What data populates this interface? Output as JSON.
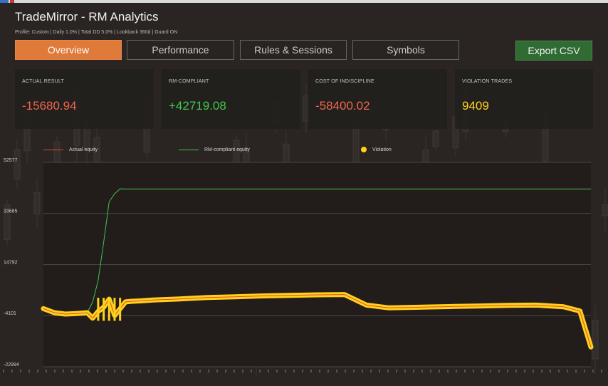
{
  "app": {
    "title": "TradeMirror - RM Analytics",
    "subtitle": "Profile: Custom  |  Daily 1.0%  |  Total DD 5.0%  |  Lookback 360d  |  Guard ON"
  },
  "tabs": [
    {
      "label": "Overview",
      "active": true
    },
    {
      "label": "Performance",
      "active": false
    },
    {
      "label": "Rules & Sessions",
      "active": false
    },
    {
      "label": "Symbols",
      "active": false
    }
  ],
  "export_label": "Export CSV",
  "cards": [
    {
      "label": "ACTUAL RESULT",
      "value": "-15680.94",
      "color": "#f0654f"
    },
    {
      "label": "RM-COMPLIANT",
      "value": "+42719.08",
      "color": "#41c94a"
    },
    {
      "label": "COST OF INDISCIPLINE",
      "value": "-58400.02",
      "color": "#f0654f"
    },
    {
      "label": "VIOLATION TRADES",
      "value": "9409",
      "color": "#ffd21a"
    }
  ],
  "legend": [
    {
      "label": "Actual equity",
      "color": "#e0473a"
    },
    {
      "label": "RM-compliant equity",
      "color": "#3fc447"
    },
    {
      "label": "Violation",
      "color": "#ffd21a"
    }
  ],
  "chart_data": {
    "type": "line",
    "title": "",
    "xlabel": "",
    "ylabel": "",
    "ylim": [
      -22994,
      52577
    ],
    "yticks": [
      52577,
      33685,
      14792,
      -4101,
      -22994
    ],
    "grid": true,
    "legend_position": "top",
    "x": [
      0,
      2,
      4,
      6,
      8,
      9,
      10,
      11,
      12,
      13,
      14,
      15,
      16,
      18,
      20,
      25,
      30,
      35,
      40,
      45,
      50,
      55,
      59,
      63,
      68,
      70,
      75,
      80,
      85,
      90,
      95,
      98,
      100
    ],
    "series": [
      {
        "name": "Actual equity",
        "color": "#e0473a",
        "values": [
          -1500,
          -3000,
          -3500,
          -3300,
          -3000,
          -5000,
          -2500,
          -1000,
          2000,
          -4000,
          -1500,
          1000,
          1200,
          1400,
          1700,
          2100,
          2600,
          2900,
          3200,
          3400,
          3600,
          3700,
          -200,
          -1200,
          -1000,
          -900,
          -700,
          -500,
          -300,
          -200,
          -800,
          -2400,
          -15680.94
        ]
      },
      {
        "name": "RM-compliant equity",
        "color": "#3fc447",
        "values": [
          -1500,
          -3000,
          -3500,
          -3300,
          -3000,
          1000,
          9000,
          23000,
          38000,
          41000,
          42800,
          42719.08,
          42719.08,
          42719.08,
          42719.08,
          42719.08,
          42719.08,
          42719.08,
          42719.08,
          42719.08,
          42719.08,
          42719.08,
          42719.08,
          42719.08,
          42719.08,
          42719.08,
          42719.08,
          42719.08,
          42719.08,
          42719.08,
          42719.08,
          42719.08,
          42719.08
        ]
      }
    ]
  }
}
